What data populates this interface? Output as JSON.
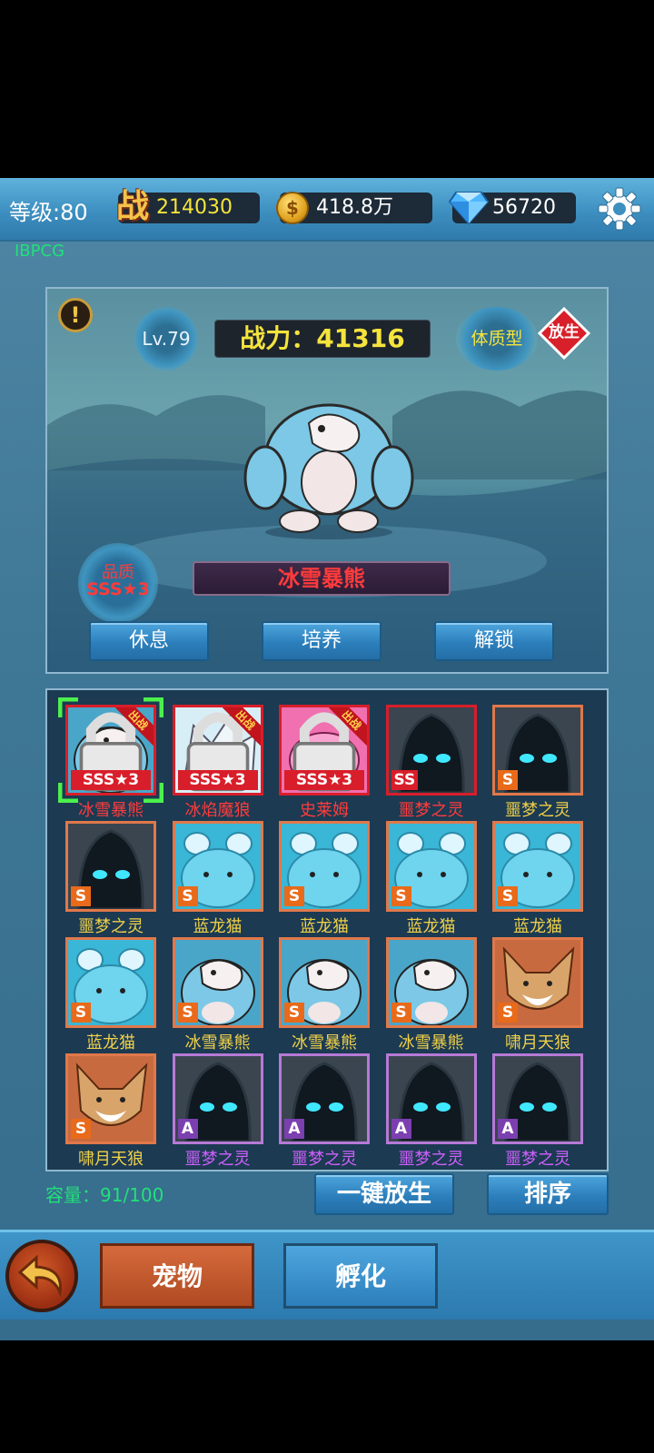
{
  "topbar": {
    "level": "等级:80",
    "power_icon": "战",
    "power": "214030",
    "coin_icon": "coin-icon",
    "gold": "418.8万",
    "gem_icon": "diamond-icon",
    "gems": "56720",
    "settings_icon": "gear-icon"
  },
  "watermark": "IBPCG",
  "pet_detail": {
    "level": "Lv.79",
    "combat_power": "战力：41316",
    "body_type": "体质型",
    "release_label": "放生",
    "quality_label": "品质",
    "quality_value": "SSS★3",
    "name": "冰雪暴熊",
    "buttons": {
      "rest": "休息",
      "train": "培养",
      "unlock": "解锁"
    }
  },
  "pets": [
    {
      "name": "冰雪暴熊",
      "grade": "SSS★3",
      "frame": "red",
      "creature": "bear",
      "locked": true,
      "deployed": true,
      "selected": true
    },
    {
      "name": "冰焰魔狼",
      "grade": "SSS★3",
      "frame": "red",
      "creature": "wolf",
      "locked": true,
      "deployed": true
    },
    {
      "name": "史莱姆",
      "grade": "SSS★3",
      "frame": "red",
      "creature": "slime",
      "locked": true,
      "deployed": true
    },
    {
      "name": "噩梦之灵",
      "grade": "SS",
      "frame": "red",
      "creature": "ghost"
    },
    {
      "name": "噩梦之灵",
      "grade": "S",
      "frame": "orange",
      "creature": "ghost"
    },
    {
      "name": "噩梦之灵",
      "grade": "S",
      "frame": "orange",
      "creature": "ghost"
    },
    {
      "name": "蓝龙猫",
      "grade": "S",
      "frame": "orange",
      "creature": "cat"
    },
    {
      "name": "蓝龙猫",
      "grade": "S",
      "frame": "orange",
      "creature": "cat"
    },
    {
      "name": "蓝龙猫",
      "grade": "S",
      "frame": "orange",
      "creature": "cat"
    },
    {
      "name": "蓝龙猫",
      "grade": "S",
      "frame": "orange",
      "creature": "cat"
    },
    {
      "name": "蓝龙猫",
      "grade": "S",
      "frame": "orange",
      "creature": "cat"
    },
    {
      "name": "冰雪暴熊",
      "grade": "S",
      "frame": "orange",
      "creature": "bear"
    },
    {
      "name": "冰雪暴熊",
      "grade": "S",
      "frame": "orange",
      "creature": "bear"
    },
    {
      "name": "冰雪暴熊",
      "grade": "S",
      "frame": "orange",
      "creature": "bear"
    },
    {
      "name": "啸月天狼",
      "grade": "S",
      "frame": "orange",
      "creature": "fox"
    },
    {
      "name": "啸月天狼",
      "grade": "S",
      "frame": "orange",
      "creature": "fox"
    },
    {
      "name": "噩梦之灵",
      "grade": "A",
      "frame": "purple",
      "creature": "ghost"
    },
    {
      "name": "噩梦之灵",
      "grade": "A",
      "frame": "purple",
      "creature": "ghost"
    },
    {
      "name": "噩梦之灵",
      "grade": "A",
      "frame": "purple",
      "creature": "ghost"
    },
    {
      "name": "噩梦之灵",
      "grade": "A",
      "frame": "purple",
      "creature": "ghost"
    }
  ],
  "deploy_ribbon": "出战",
  "capacity": "容量：91/100",
  "actions": {
    "release_all": "一键放生",
    "sort": "排序"
  },
  "nav": {
    "tab_pets": "宠物",
    "tab_hatch": "孵化",
    "back_icon": "back-arrow-icon"
  },
  "colors": {
    "grade_red": "#d81e2a",
    "grade_orange": "#e86a1a",
    "grade_purple": "#7b3fb0",
    "name_yellow": "#f0d048",
    "name_red": "#ff3b3b",
    "name_purple": "#d060ff",
    "capacity_green": "#22e07a"
  }
}
